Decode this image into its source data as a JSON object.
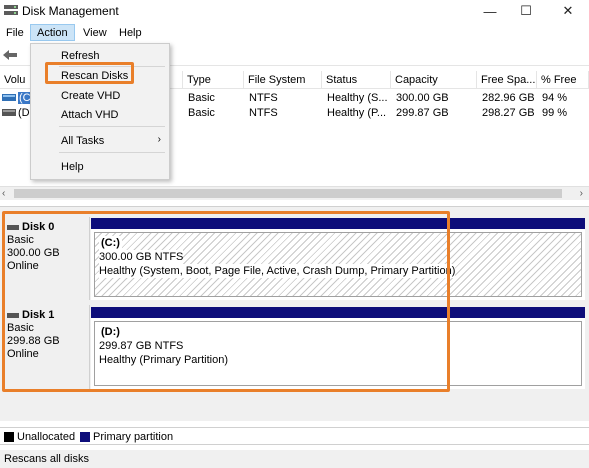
{
  "window": {
    "title": "Disk Management",
    "minimize": "—",
    "maximize": "☐",
    "close": "✕"
  },
  "menu": {
    "file": "File",
    "action": "Action",
    "view": "View",
    "help": "Help"
  },
  "columns": {
    "volume": "Volu",
    "type": "Type",
    "file_system": "File System",
    "status": "Status",
    "capacity": "Capacity",
    "free_space": "Free Spa...",
    "pct_free": "% Free"
  },
  "volumes": [
    {
      "name": "(C",
      "type": "Basic",
      "file_system": "NTFS",
      "status": "Healthy (S...",
      "capacity": "300.00 GB",
      "free_space": "282.96 GB",
      "pct_free": "94 %"
    },
    {
      "name": "(D",
      "type": "Basic",
      "file_system": "NTFS",
      "status": "Healthy (P...",
      "capacity": "299.87 GB",
      "free_space": "298.27 GB",
      "pct_free": "99 %"
    }
  ],
  "action_menu": {
    "refresh": "Refresh",
    "rescan_disks": "Rescan Disks",
    "create_vhd": "Create VHD",
    "attach_vhd": "Attach VHD",
    "all_tasks": "All Tasks",
    "all_tasks_arrow": "›",
    "help": "Help"
  },
  "scroll": {
    "left": "‹",
    "right": "›"
  },
  "disks": [
    {
      "name": "Disk 0",
      "type": "Basic",
      "size": "300.00 GB",
      "state": "Online",
      "partition": {
        "letter": "(C:)",
        "size_fs": "300.00 GB NTFS",
        "status": "Healthy (System, Boot, Page File, Active, Crash Dump, Primary Partition)"
      }
    },
    {
      "name": "Disk 1",
      "type": "Basic",
      "size": "299.88 GB",
      "state": "Online",
      "partition": {
        "letter": "(D:)",
        "size_fs": "299.87 GB NTFS",
        "status": "Healthy (Primary Partition)"
      }
    }
  ],
  "legend": {
    "unallocated": "Unallocated",
    "primary": "Primary partition",
    "unallocated_color": "#000000",
    "primary_color": "#0d0d7a"
  },
  "status_bar": "Rescans all disks",
  "colors": {
    "highlight": "#e97f2a",
    "partition_bar": "#0d0d7a",
    "menu_selected": "#cce4f7"
  }
}
